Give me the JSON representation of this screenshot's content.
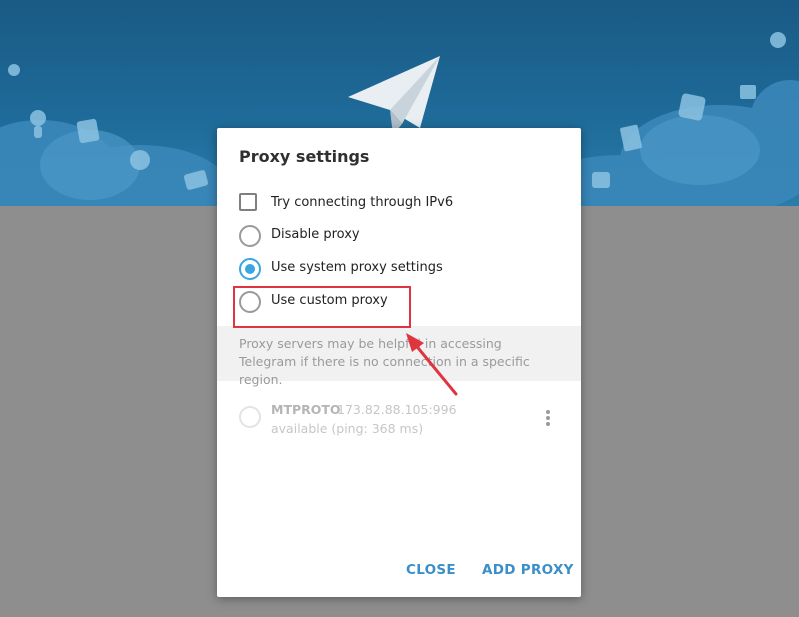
{
  "dialog": {
    "title": "Proxy settings",
    "options": [
      {
        "label": "Try connecting through IPv6",
        "type": "checkbox",
        "checked": false
      },
      {
        "label": "Disable proxy",
        "type": "radio",
        "checked": false
      },
      {
        "label": "Use system proxy settings",
        "type": "radio",
        "checked": true
      },
      {
        "label": "Use custom proxy",
        "type": "radio",
        "checked": false
      }
    ],
    "info_text": "Proxy servers may be helpful in accessing Telegram if there is no connection in a specific region.",
    "proxy": {
      "type": "MTPROTO",
      "address": "173.82.88.105:996",
      "status": "available (ping: 368 ms)"
    },
    "buttons": {
      "close": "CLOSE",
      "add_proxy": "ADD PROXY"
    }
  },
  "colors": {
    "accent": "#3aa5de",
    "button_text": "#3a8fc8",
    "annotation": "#e0343e",
    "header_bg": "#1e6a98"
  },
  "icons": [
    "telegram-plane-icon",
    "menu-dots-icon",
    "annotation-arrow-icon"
  ]
}
